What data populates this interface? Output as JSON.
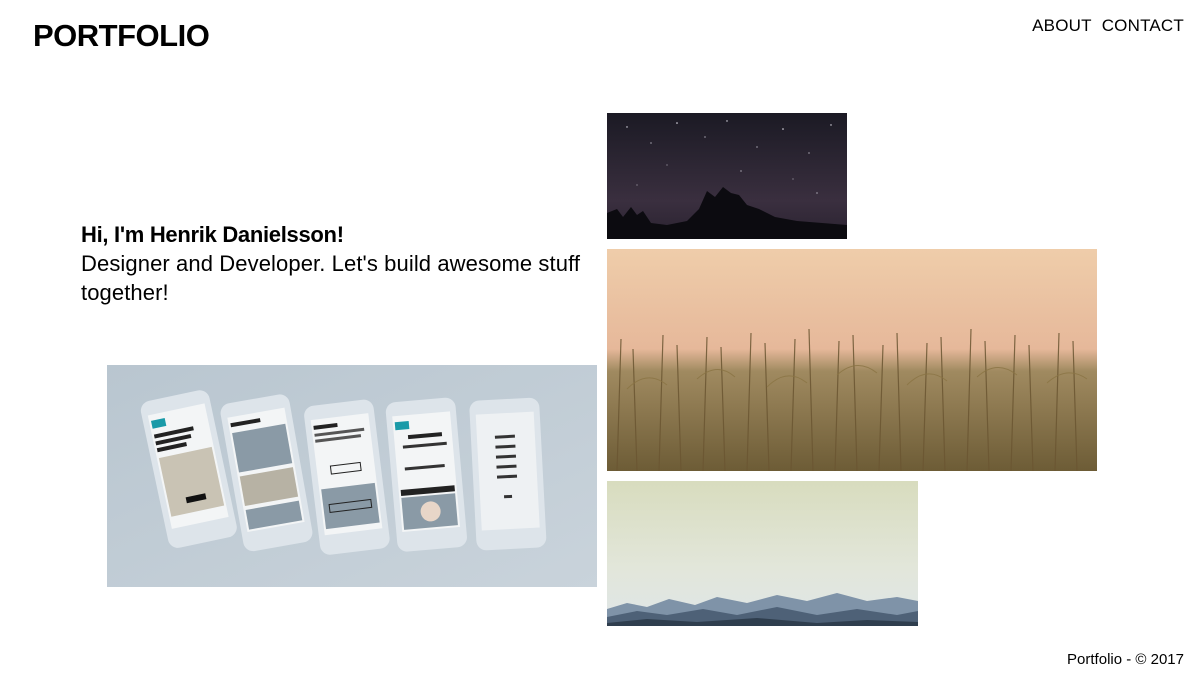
{
  "header": {
    "logo": "PORTFOLIO",
    "nav": [
      {
        "label": "ABOUT"
      },
      {
        "label": "CONTACT"
      }
    ]
  },
  "intro": {
    "heading": "Hi, I'm Henrik Danielsson!",
    "text": "Designer and Developer. Let's build awesome stuff together!"
  },
  "gallery": [
    {
      "subject": "mobile app mockups on five phones"
    },
    {
      "subject": "night sky with stars over treetops"
    },
    {
      "subject": "corn field at sunset"
    },
    {
      "subject": "misty mountain range"
    }
  ],
  "footer": {
    "text": "Portfolio - © 2017"
  },
  "colors": {
    "background": "#ffffff",
    "text": "#000000"
  }
}
